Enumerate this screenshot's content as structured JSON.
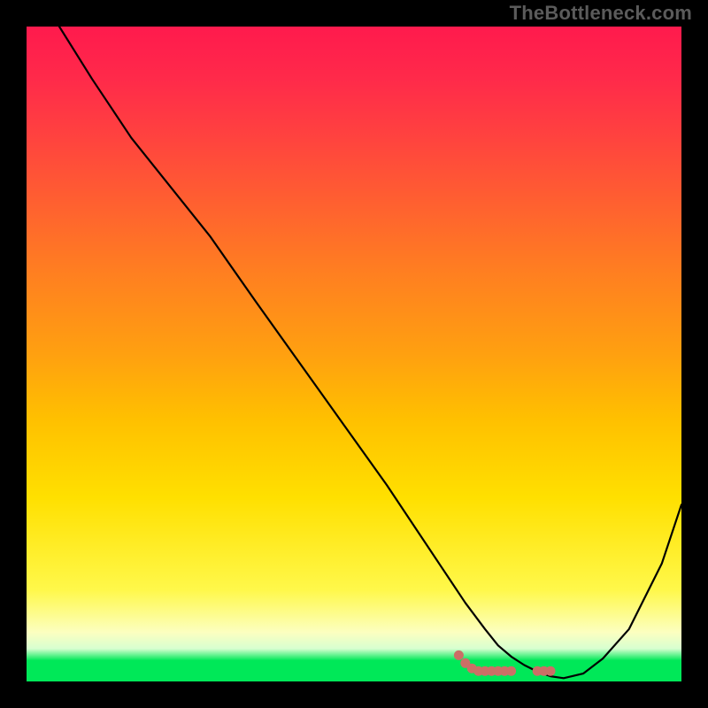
{
  "watermark": "TheBottleneck.com",
  "chart_data": {
    "type": "line",
    "title": "",
    "xlabel": "",
    "ylabel": "",
    "xlim": [
      0,
      100
    ],
    "ylim": [
      0,
      100
    ],
    "series": [
      {
        "name": "curve",
        "color": "#000000",
        "x": [
          5,
          10,
          16,
          24,
          28,
          35,
          45,
          55,
          63,
          67,
          70,
          72,
          74,
          76,
          78,
          80,
          82,
          85,
          88,
          92,
          97,
          100
        ],
        "y": [
          100,
          92,
          83,
          73,
          68,
          58,
          44,
          30,
          18,
          12,
          8,
          5.5,
          3.8,
          2.5,
          1.5,
          0.8,
          0.5,
          1.2,
          3.5,
          8,
          18,
          27
        ]
      },
      {
        "name": "dots",
        "color": "#cc6f66",
        "style": "dotted",
        "x": [
          66,
          67,
          68,
          69,
          70,
          71,
          72,
          73,
          74,
          78,
          79,
          80
        ],
        "y": [
          4.0,
          2.8,
          2.0,
          1.6,
          1.6,
          1.6,
          1.6,
          1.6,
          1.6,
          1.6,
          1.6,
          1.6
        ]
      }
    ]
  },
  "colors": {
    "curve": "#000000",
    "dots": "#cc6f66",
    "frame": "#000000"
  }
}
